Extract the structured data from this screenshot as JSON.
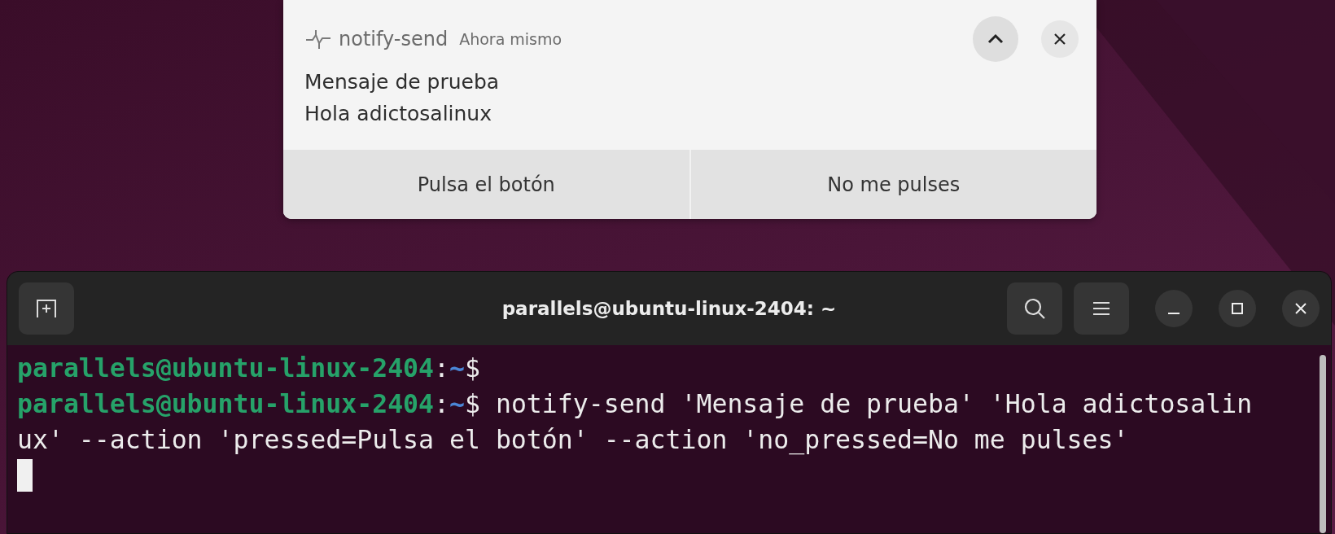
{
  "notification": {
    "app_name": "notify-send",
    "time": "Ahora mismo",
    "title": "Mensaje de prueba",
    "body": "Hola adictosalinux",
    "actions": [
      {
        "label": "Pulsa el botón"
      },
      {
        "label": "No me pulses"
      }
    ]
  },
  "terminal": {
    "title": "parallels@ubuntu-linux-2404: ~",
    "lines": [
      {
        "kind": "prompt",
        "user_host": "parallels@ubuntu-linux-2404",
        "separator": ":",
        "path": "~",
        "symbol": "$"
      },
      {
        "kind": "prompt",
        "user_host": "parallels@ubuntu-linux-2404",
        "separator": ":",
        "path": "~",
        "symbol": "$",
        "command": " notify-send 'Mensaje de prueba' 'Hola adictosalin"
      },
      {
        "kind": "text",
        "text": "ux' --action 'pressed=Pulsa el botón' --action 'no_pressed=No me pulses'"
      },
      {
        "kind": "cursor"
      }
    ]
  }
}
